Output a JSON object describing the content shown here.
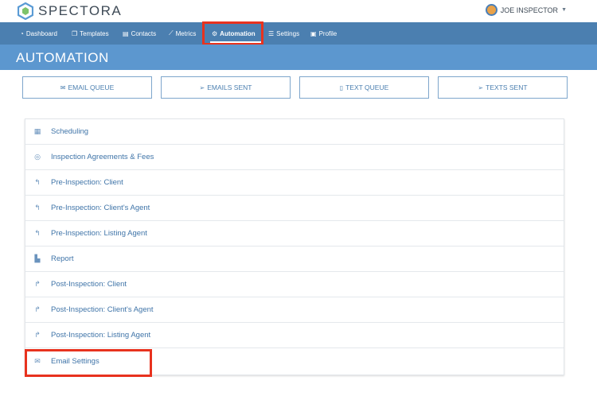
{
  "app": {
    "logo_text": "SPECTORA",
    "user_name": "JOE INSPECTOR"
  },
  "nav": {
    "items": [
      {
        "label": "Dashboard",
        "icon": "dashboard-icon"
      },
      {
        "label": "Templates",
        "icon": "copy-icon"
      },
      {
        "label": "Contacts",
        "icon": "contacts-card-icon"
      },
      {
        "label": "Metrics",
        "icon": "line-chart-icon"
      },
      {
        "label": "Automation",
        "icon": "gears-icon",
        "active": true
      },
      {
        "label": "Settings",
        "icon": "sliders-icon"
      },
      {
        "label": "Profile",
        "icon": "briefcase-icon"
      }
    ]
  },
  "page": {
    "title": "AUTOMATION"
  },
  "tabs": [
    {
      "label": "EMAIL QUEUE",
      "icon": "envelope-icon"
    },
    {
      "label": "EMAILS SENT",
      "icon": "paper-plane-icon"
    },
    {
      "label": "TEXT QUEUE",
      "icon": "mobile-icon"
    },
    {
      "label": "TEXTS SENT",
      "icon": "paper-plane-icon"
    }
  ],
  "list": {
    "items": [
      {
        "label": "Scheduling",
        "icon": "calendar-icon"
      },
      {
        "label": "Inspection Agreements & Fees",
        "icon": "handshake-icon"
      },
      {
        "label": "Pre-Inspection: Client",
        "icon": "reply-icon"
      },
      {
        "label": "Pre-Inspection: Client's Agent",
        "icon": "reply-icon"
      },
      {
        "label": "Pre-Inspection: Listing Agent",
        "icon": "reply-icon"
      },
      {
        "label": "Report",
        "icon": "file-icon"
      },
      {
        "label": "Post-Inspection: Client",
        "icon": "share-icon"
      },
      {
        "label": "Post-Inspection: Client's Agent",
        "icon": "share-icon"
      },
      {
        "label": "Post-Inspection: Listing Agent",
        "icon": "share-icon"
      },
      {
        "label": "Email Settings",
        "icon": "envelope-icon"
      }
    ]
  },
  "colors": {
    "nav_bg": "#4b7fb0",
    "banner_bg": "#5c97cf",
    "highlight": "#e8321e",
    "link": "#3f74a8"
  }
}
